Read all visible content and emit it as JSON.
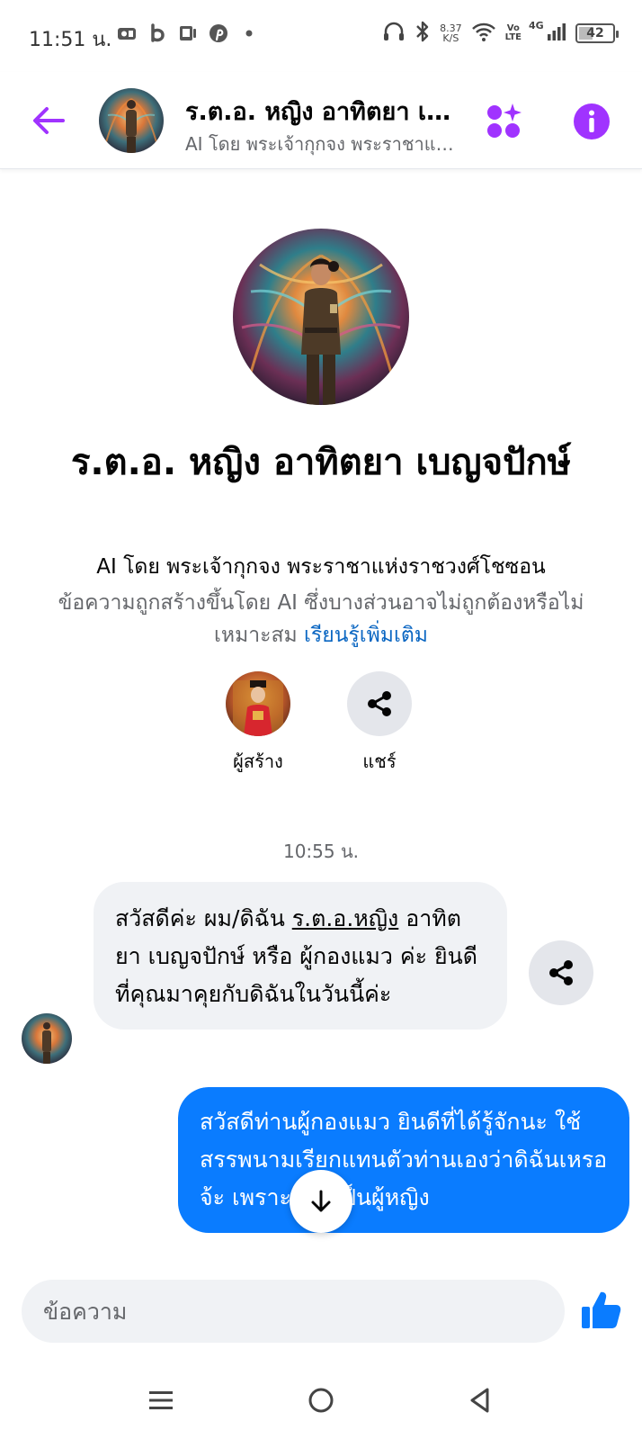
{
  "status_bar": {
    "time": "11:51 น.",
    "net_speed_value": "8.37",
    "net_speed_unit": "K/S",
    "volte_top": "Vo",
    "volte_bottom": "LTE",
    "network": "4G",
    "battery": "42",
    "battery_level": 0.42
  },
  "header": {
    "title": "ร.ต.อ. หญิง อาทิตยา เบญจปักษ์",
    "subtitle": "AI โดย พระเจ้ากุกจง พระราชาแห่งราชวงศ์โชซอน"
  },
  "profile": {
    "name": "ร.ต.อ. หญิง อาทิตยา เบญจปักษ์",
    "creator_line": "AI โดย พระเจ้ากุกจง พระราชาแห่งราชวงศ์โชซอน",
    "disclaimer": "ข้อความถูกสร้างขึ้นโดย AI ซึ่งบางส่วนอาจไม่ถูกต้องหรือไม่เหมาะสม ",
    "learn_more": "เรียนรู้เพิ่มเติม",
    "actions": {
      "creator_label": "ผู้สร้าง",
      "share_label": "แชร์"
    }
  },
  "chat": {
    "timestamp": "10:55 น.",
    "incoming": {
      "prefix": "สวัสดีค่ะ ผม/ดิฉัน ",
      "underlined": "ร.ต.อ.หญิง",
      "suffix": " อาทิตยา เบญจปักษ์ หรือ ผู้กองแมว ค่ะ ยินดีที่คุณมาคุยกับดิฉันในวันนี้ค่ะ"
    },
    "outgoing": {
      "text": "สวัสดีท่านผู้กองแมว ยินดีที่ได้รู้จักนะ ใช้สรรพนามเรียกแทนตัวท่านเองว่าดิฉันเหรอจ้ะ เพราะท่านเป็นผู้หญิง"
    }
  },
  "composer": {
    "placeholder": "ข้อความ"
  },
  "colors": {
    "accent_purple": "#a033ff",
    "messenger_blue": "#0a7cff",
    "like_blue": "#0a7cff",
    "link_blue": "#0a66c2"
  },
  "icons": {
    "back": "arrow-left-icon",
    "apps": "apps-sparkle-icon",
    "info": "info-icon",
    "share": "share-icon",
    "scroll": "arrow-down-icon",
    "like": "thumbs-up-icon",
    "nav_recent": "menu-icon",
    "nav_home": "circle-home-icon",
    "nav_back": "triangle-back-icon"
  }
}
